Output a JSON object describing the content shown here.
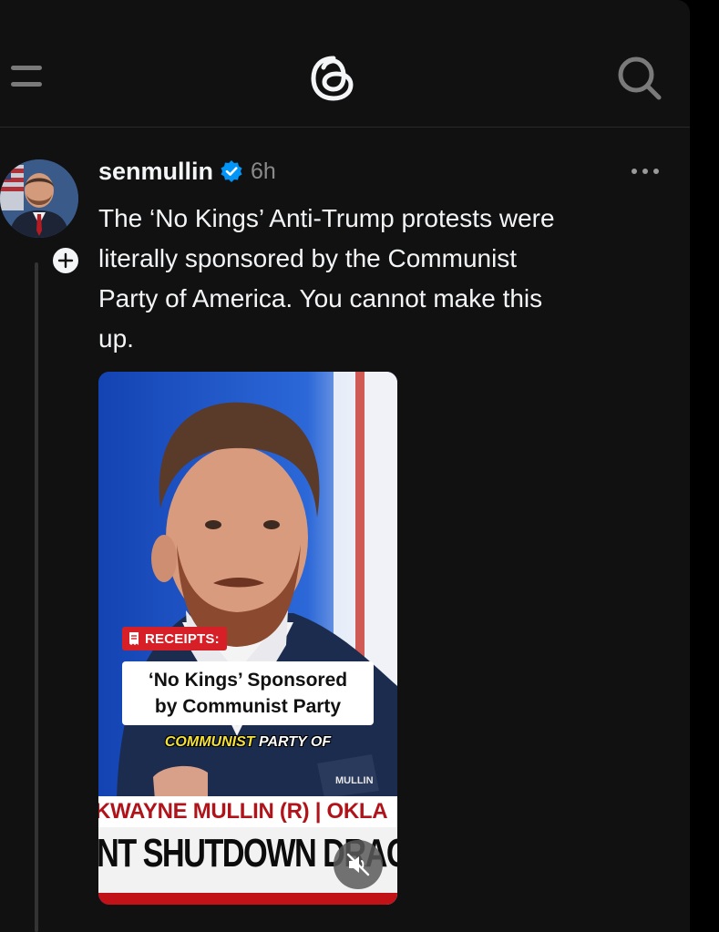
{
  "header": {
    "menu_icon": "hamburger-icon",
    "logo_icon": "threads-logo-icon",
    "search_icon": "search-icon"
  },
  "post": {
    "username": "senmullin",
    "verified": true,
    "time": "6h",
    "text": "The ‘No Kings’ Anti-Trump protests were\nliterally sponsored by the Communist\nParty of America. You cannot make this\nup.",
    "media": {
      "tag": "RECEIPTS:",
      "caption": "‘No Kings’ Sponsored\nby Communist Party",
      "subtitle_highlight": "COMMUNIST",
      "subtitle_rest": " PARTY OF",
      "chyron_name": "KWAYNE MULLIN (R) | OKLA",
      "chyron_headline": "NT SHUTDOWN DRAG"
    }
  },
  "colors": {
    "background": "#111111",
    "text": "#f3f5f7",
    "muted": "#8a8a8a",
    "verified": "#0095f6",
    "tag_red": "#d61f26",
    "subtitle_yellow": "#f4e23a"
  }
}
